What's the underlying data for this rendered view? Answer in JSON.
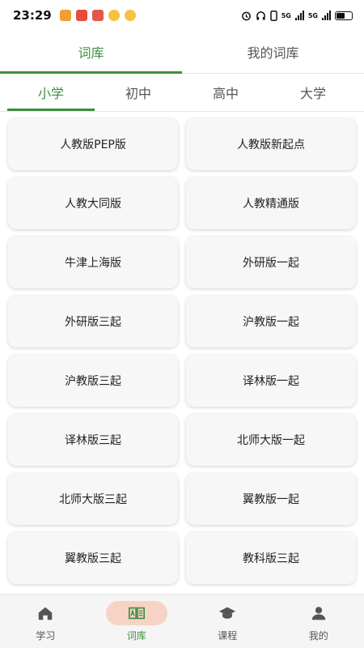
{
  "status_bar": {
    "time": "23:29",
    "network_1": "5G",
    "network_2": "5G"
  },
  "top_tabs": [
    {
      "label": "词库",
      "active": true
    },
    {
      "label": "我的词库",
      "active": false
    }
  ],
  "level_tabs": [
    {
      "label": "小学",
      "active": true
    },
    {
      "label": "初中",
      "active": false
    },
    {
      "label": "高中",
      "active": false
    },
    {
      "label": "大学",
      "active": false
    }
  ],
  "textbooks": [
    "人教版PEP版",
    "人教版新起点",
    "人教大同版",
    "人教精通版",
    "牛津上海版",
    "外研版一起",
    "外研版三起",
    "沪教版一起",
    "沪教版三起",
    "译林版一起",
    "译林版三起",
    "北师大版一起",
    "北师大版三起",
    "翼教版一起",
    "翼教版三起",
    "教科版三起"
  ],
  "bottom_nav": [
    {
      "label": "学习",
      "icon": "home-icon",
      "active": false
    },
    {
      "label": "词库",
      "icon": "book-icon",
      "active": true
    },
    {
      "label": "课程",
      "icon": "graduation-cap-icon",
      "active": false
    },
    {
      "label": "我的",
      "icon": "user-icon",
      "active": false
    }
  ],
  "colors": {
    "accent": "#3e8e41",
    "active_pill": "#f7d3c5",
    "card_bg": "#f7f7f7"
  }
}
